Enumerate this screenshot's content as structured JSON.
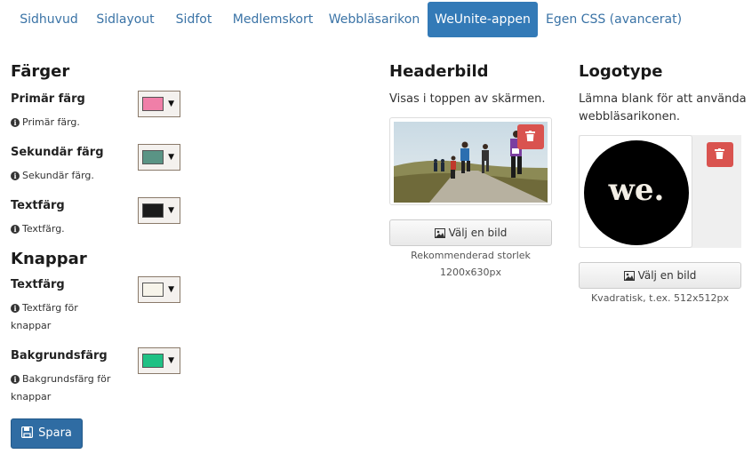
{
  "tabs": [
    {
      "label": "Sidhuvud"
    },
    {
      "label": "Sidlayout"
    },
    {
      "label": "Sidfot"
    },
    {
      "label": "Medlemskort"
    },
    {
      "label": "Webbläsarikon"
    },
    {
      "label": "WeUnite-appen",
      "active": true
    },
    {
      "label": "Egen CSS (avancerat)"
    }
  ],
  "colors_section": {
    "title": "Färger",
    "primary": {
      "label": "Primär färg",
      "help": "Primär färg.",
      "color": "#f07fa8"
    },
    "secondary": {
      "label": "Sekundär färg",
      "help": "Sekundär färg.",
      "color": "#5a9485"
    },
    "text": {
      "label": "Textfärg",
      "help": "Textfärg.",
      "color": "#1b1b1b"
    }
  },
  "buttons_section": {
    "title": "Knappar",
    "text": {
      "label": "Textfärg",
      "help_line1": "Textfärg för",
      "help_line2": "knappar",
      "color": "#f7f4ea"
    },
    "background": {
      "label": "Bakgrundsfärg",
      "help_line1": "Bakgrundsfärg för",
      "help_line2": "knappar",
      "color": "#1fc184"
    }
  },
  "header_image": {
    "title": "Headerbild",
    "description": "Visas i toppen av skärmen.",
    "choose_label": "Välj en bild",
    "hint_line1": "Rekommenderad storlek",
    "hint_line2": "1200x630px"
  },
  "logo": {
    "title": "Logotype",
    "description_line1": "Lämna blank för att använda",
    "description_line2": "webbläsarikonen.",
    "logo_text": "we.",
    "choose_label": "Välj en bild",
    "hint": "Kvadratisk, t.ex. 512x512px"
  },
  "save_label": "Spara",
  "accent": "#337ab7",
  "danger": "#d9534f"
}
